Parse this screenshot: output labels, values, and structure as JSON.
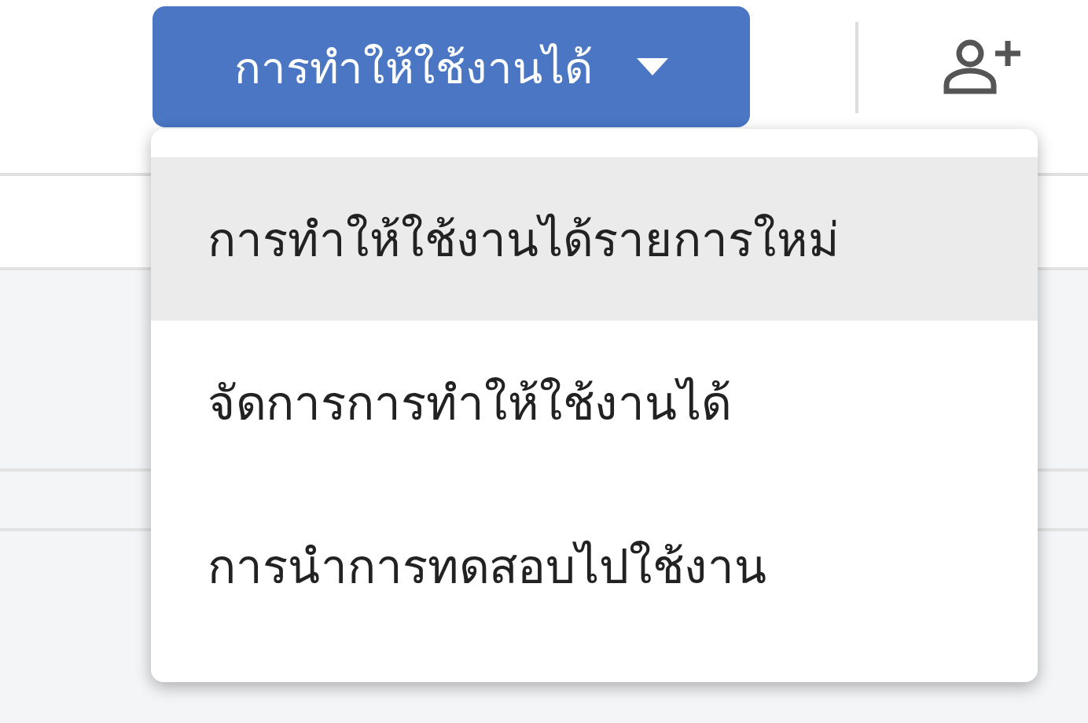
{
  "toolbar": {
    "deploy_button": {
      "label": "การทำให้ใช้งานได้",
      "expanded": true
    }
  },
  "menu": {
    "items": [
      {
        "label": "การทำให้ใช้งานได้รายการใหม่",
        "selected": true
      },
      {
        "label": "จัดการการทำให้ใช้งานได้",
        "selected": false
      },
      {
        "label": "การนำการทดสอบไปใช้งาน",
        "selected": false
      }
    ]
  }
}
